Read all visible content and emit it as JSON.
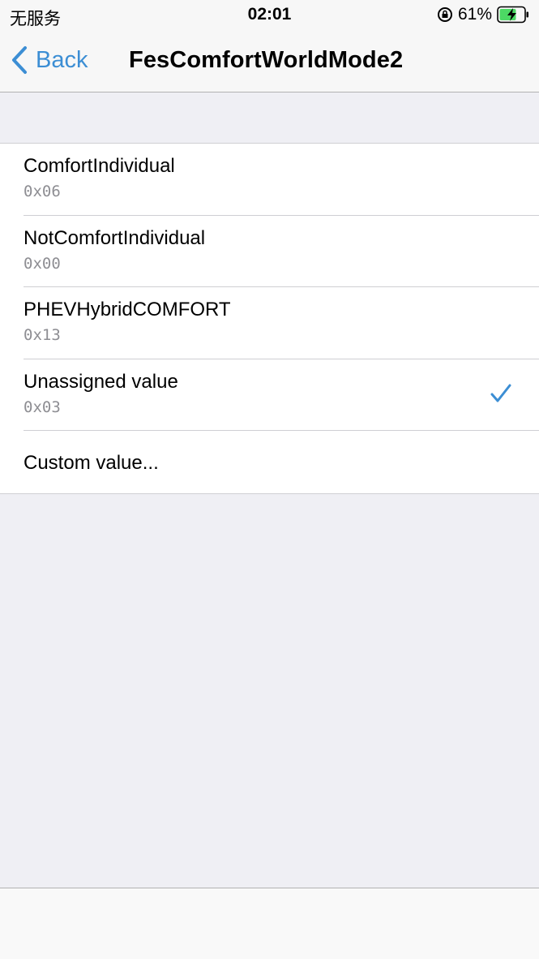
{
  "status_bar": {
    "carrier": "无服务",
    "time": "02:01",
    "battery_percent": "61%",
    "icons": [
      "orientation-lock-icon",
      "battery-charging-icon"
    ]
  },
  "nav": {
    "back_label": "Back",
    "title": "FesComfortWorldMode2"
  },
  "options": [
    {
      "title": "ComfortIndividual",
      "value": "0x06",
      "selected": false
    },
    {
      "title": "NotComfortIndividual",
      "value": "0x00",
      "selected": false
    },
    {
      "title": "PHEVHybridCOMFORT",
      "value": "0x13",
      "selected": false
    },
    {
      "title": "Unassigned value",
      "value": "0x03",
      "selected": true
    }
  ],
  "custom_option": {
    "title": "Custom value..."
  },
  "colors": {
    "accent": "#3c8ed4",
    "background": "#efeff4",
    "subtitle": "#8e8e93",
    "battery_charging": "#4cd964"
  }
}
